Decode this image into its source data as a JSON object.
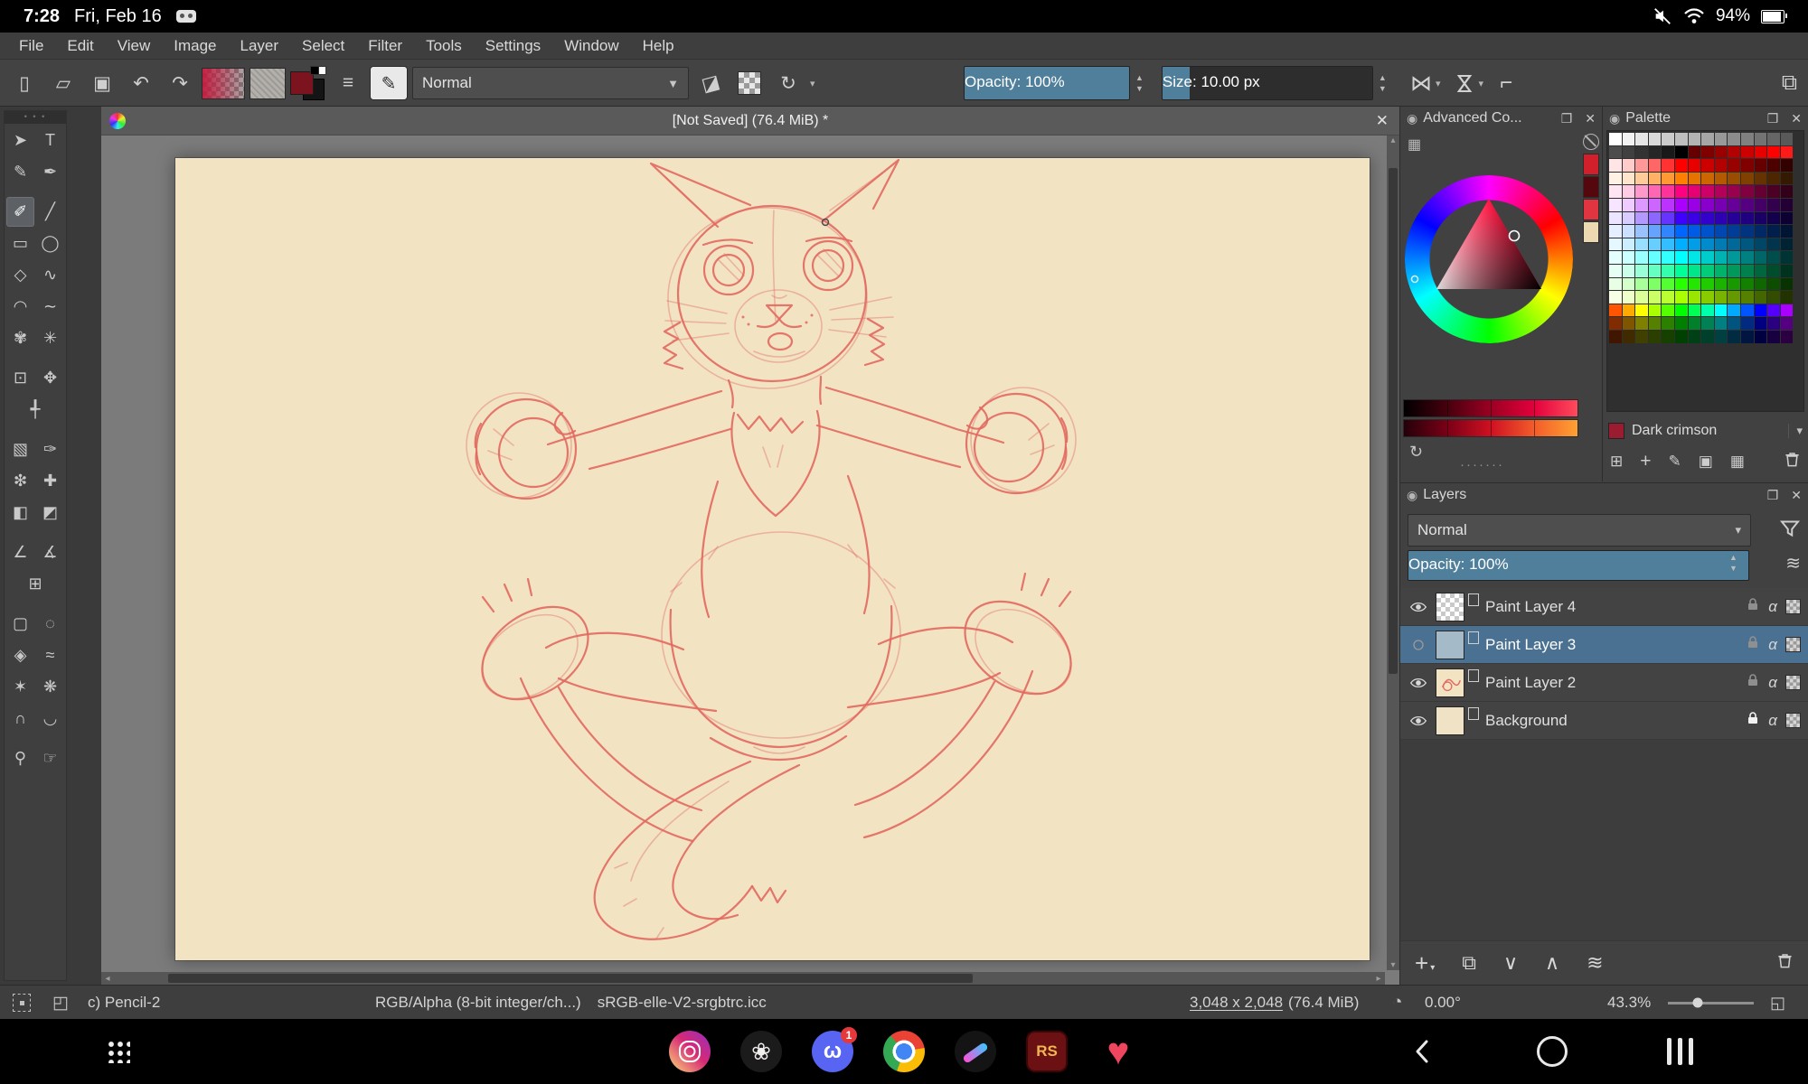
{
  "colors": {
    "accent_teal": "#4f7f9b",
    "selection_blue": "#4a7191",
    "canvas_paper": "#f2e3c3",
    "sketch": "#e2685f"
  },
  "status_bar": {
    "time": "7:28",
    "date": "Fri, Feb 16",
    "battery_percent": "94%"
  },
  "menu_bar": {
    "items": [
      "File",
      "Edit",
      "View",
      "Image",
      "Layer",
      "Select",
      "Filter",
      "Tools",
      "Settings",
      "Window",
      "Help"
    ]
  },
  "toolbar": {
    "blending_mode": "Normal",
    "opacity_label": "Opacity: 100%",
    "size_label": "Size: 10.00 px"
  },
  "document_tab": {
    "title": "[Not Saved]  (76.4 MiB)  *"
  },
  "toolbox": {
    "rows": [
      {
        "gap": false,
        "tools": [
          {
            "name": "shape-select-tool",
            "glyph": "➤"
          },
          {
            "name": "text-tool",
            "glyph": "T"
          }
        ]
      },
      {
        "gap": false,
        "tools": [
          {
            "name": "edit-shapes-tool",
            "glyph": "✎"
          },
          {
            "name": "calligraphy-tool",
            "glyph": "✒"
          }
        ]
      },
      {
        "gap": true,
        "tools": [
          {
            "name": "freehand-brush-tool",
            "glyph": "✐",
            "selected": true
          },
          {
            "name": "line-tool",
            "glyph": "╱"
          }
        ]
      },
      {
        "gap": false,
        "tools": [
          {
            "name": "rectangle-tool",
            "glyph": "▭"
          },
          {
            "name": "ellipse-tool",
            "glyph": "◯"
          }
        ]
      },
      {
        "gap": false,
        "tools": [
          {
            "name": "polygon-tool",
            "glyph": "◇"
          },
          {
            "name": "polyline-tool",
            "glyph": "∿"
          }
        ]
      },
      {
        "gap": false,
        "tools": [
          {
            "name": "bezier-curve-tool",
            "glyph": "◠"
          },
          {
            "name": "freehand-path-tool",
            "glyph": "∼"
          }
        ]
      },
      {
        "gap": false,
        "tools": [
          {
            "name": "dynamic-brush-tool",
            "glyph": "✾"
          },
          {
            "name": "multibrush-tool",
            "glyph": "✳"
          }
        ]
      },
      {
        "gap": true,
        "tools": [
          {
            "name": "transform-tool",
            "glyph": "⊡"
          },
          {
            "name": "move-tool",
            "glyph": "✥"
          }
        ]
      },
      {
        "gap": false,
        "tools": [
          {
            "name": "crop-tool",
            "glyph": "╃"
          }
        ]
      },
      {
        "gap": true,
        "tools": [
          {
            "name": "gradient-tool",
            "glyph": "▧"
          },
          {
            "name": "color-sampler-tool",
            "glyph": "✑"
          }
        ]
      },
      {
        "gap": false,
        "tools": [
          {
            "name": "colorize-mask-tool",
            "glyph": "❇"
          },
          {
            "name": "smart-patch-tool",
            "glyph": "✚"
          }
        ]
      },
      {
        "gap": false,
        "tools": [
          {
            "name": "fill-tool",
            "glyph": "◧"
          },
          {
            "name": "enclose-fill-tool",
            "glyph": "◩"
          }
        ]
      },
      {
        "gap": true,
        "tools": [
          {
            "name": "assistants-tool",
            "glyph": "∠"
          },
          {
            "name": "measure-tool",
            "glyph": "∡"
          }
        ]
      },
      {
        "gap": false,
        "tools": [
          {
            "name": "reference-images-tool",
            "glyph": "⊞"
          }
        ]
      },
      {
        "gap": true,
        "tools": [
          {
            "name": "rectangular-selection-tool",
            "glyph": "▢"
          },
          {
            "name": "elliptical-selection-tool",
            "glyph": "◌"
          }
        ]
      },
      {
        "gap": false,
        "tools": [
          {
            "name": "polygonal-selection-tool",
            "glyph": "◈"
          },
          {
            "name": "freehand-selection-tool",
            "glyph": "≈"
          }
        ]
      },
      {
        "gap": false,
        "tools": [
          {
            "name": "contiguous-selection-tool",
            "glyph": "✶"
          },
          {
            "name": "similar-color-selection-tool",
            "glyph": "❋"
          }
        ]
      },
      {
        "gap": false,
        "tools": [
          {
            "name": "magnetic-selection-tool",
            "glyph": "∩"
          },
          {
            "name": "bezier-selection-tool",
            "glyph": "◡"
          }
        ]
      },
      {
        "gap": true,
        "tools": [
          {
            "name": "zoom-tool",
            "glyph": "⚲"
          },
          {
            "name": "pan-tool",
            "glyph": "☞"
          }
        ]
      }
    ]
  },
  "advanced_color_selector": {
    "title": "Advanced Co...",
    "recent_colors": [
      "#d1202c",
      "#54070d",
      "#e03440",
      "#ecd9b2"
    ],
    "gradient_strip_top": [
      "#000000",
      "#47000e",
      "#9b0022",
      "#e3003c",
      "#ff4b5c"
    ],
    "gradient_strip_bottom": [
      "#24000a",
      "#7a0016",
      "#cf1022",
      "#f25c2a",
      "#ffa133"
    ]
  },
  "palette": {
    "title": "Palette",
    "selected_color_name": "Dark crimson",
    "selected_color_hex": "#9b1b30",
    "rows": [
      [
        "#ffffff",
        "#f2f2f2",
        "#e6e6e6",
        "#d9d9d9",
        "#cccccc",
        "#bfbfbf",
        "#b3b3b3",
        "#a6a6a6",
        "#999999",
        "#8c8c8c",
        "#808080",
        "#737373",
        "#666666",
        "#595959"
      ],
      [
        "#4d4d4d",
        "#404040",
        "#333333",
        "#262626",
        "#191919",
        "#000000",
        "#660000",
        "#800000",
        "#990000",
        "#b30000",
        "#cc0000",
        "#e60000",
        "#ff0000",
        "#ff1a1a"
      ],
      [
        "#ffe5e5",
        "#ffcccc",
        "#ff9999",
        "#ff6666",
        "#ff3333",
        "#ff0000",
        "#e60000",
        "#cc0000",
        "#b30000",
        "#990000",
        "#800000",
        "#660000",
        "#4d0000",
        "#330000"
      ],
      [
        "#fff2e5",
        "#ffe5cc",
        "#ffcc99",
        "#ffb266",
        "#ff9933",
        "#ff8000",
        "#e67300",
        "#cc6600",
        "#b35900",
        "#994d00",
        "#804000",
        "#663300",
        "#4d2600",
        "#331a00"
      ],
      [
        "#ffe5f2",
        "#ffcce6",
        "#ff99cc",
        "#ff66b3",
        "#ff3399",
        "#ff0080",
        "#e60073",
        "#cc0066",
        "#b30059",
        "#99004d",
        "#800040",
        "#660033",
        "#4d0026",
        "#33001a"
      ],
      [
        "#f7e5ff",
        "#eeccff",
        "#dd99ff",
        "#cc66ff",
        "#bb33ff",
        "#aa00ff",
        "#9900e6",
        "#8800cc",
        "#7700b3",
        "#660099",
        "#550080",
        "#440066",
        "#33004d",
        "#220033"
      ],
      [
        "#ece5ff",
        "#d9ccff",
        "#b399ff",
        "#8c66ff",
        "#6633ff",
        "#4000ff",
        "#3a00e6",
        "#3300cc",
        "#2d00b3",
        "#260099",
        "#200080",
        "#1a0066",
        "#13004d",
        "#0d0033"
      ],
      [
        "#e5efff",
        "#cce0ff",
        "#99c2ff",
        "#66a3ff",
        "#3385ff",
        "#0066ff",
        "#005ce6",
        "#0052cc",
        "#0047b3",
        "#003d99",
        "#003380",
        "#002966",
        "#001f4d",
        "#001433"
      ],
      [
        "#e5f7ff",
        "#ccefff",
        "#99dfff",
        "#66cfff",
        "#33bfff",
        "#00afff",
        "#009ee6",
        "#008ccc",
        "#007bb3",
        "#006999",
        "#005880",
        "#004666",
        "#00354d",
        "#002333"
      ],
      [
        "#e5ffff",
        "#ccffff",
        "#99ffff",
        "#66ffff",
        "#33ffff",
        "#00ffff",
        "#00e6e6",
        "#00cccc",
        "#00b3b3",
        "#009999",
        "#008080",
        "#006666",
        "#004d4d",
        "#003333"
      ],
      [
        "#e5fff5",
        "#ccffeb",
        "#99ffd6",
        "#66ffc2",
        "#33ffad",
        "#00ff99",
        "#00e68a",
        "#00cc7a",
        "#00b36b",
        "#00995c",
        "#00804d",
        "#00663d",
        "#004d2e",
        "#00331f"
      ],
      [
        "#e9ffe5",
        "#d4ffcc",
        "#a9ff99",
        "#7eff66",
        "#53ff33",
        "#28ff00",
        "#24e600",
        "#20cc00",
        "#1cb300",
        "#189900",
        "#148000",
        "#106600",
        "#0c4d00",
        "#083300"
      ],
      [
        "#f7ffe5",
        "#eeffcc",
        "#ddff99",
        "#ccff66",
        "#bbff33",
        "#aaff00",
        "#99e600",
        "#88cc00",
        "#77b300",
        "#669900",
        "#558000",
        "#446600",
        "#334d00",
        "#223300"
      ],
      [
        "#ff5500",
        "#ffaa00",
        "#ffff00",
        "#aaff00",
        "#55ff00",
        "#00ff00",
        "#00ff55",
        "#00ffaa",
        "#00ffff",
        "#00aaff",
        "#0055ff",
        "#0000ff",
        "#5500ff",
        "#aa00ff"
      ],
      [
        "#802b00",
        "#805500",
        "#808000",
        "#558000",
        "#2b8000",
        "#008000",
        "#00802b",
        "#008055",
        "#008080",
        "#005580",
        "#002b80",
        "#000080",
        "#2b0080",
        "#550080"
      ],
      [
        "#401600",
        "#402b00",
        "#404000",
        "#2b4000",
        "#164000",
        "#004000",
        "#004016",
        "#00402b",
        "#004040",
        "#002b40",
        "#001640",
        "#000040",
        "#160040",
        "#2b0040"
      ]
    ]
  },
  "layers": {
    "title": "Layers",
    "blending_mode": "Normal",
    "opacity_label": "Opacity:  100%",
    "items": [
      {
        "name": "Paint Layer 4",
        "visible": true,
        "selected": false,
        "locked": false,
        "thumb": "thumb-checker"
      },
      {
        "name": "Paint Layer 3",
        "visible": false,
        "selected": true,
        "locked": false,
        "thumb": "thumb-blue"
      },
      {
        "name": "Paint Layer 2",
        "visible": true,
        "selected": false,
        "locked": false,
        "thumb": "thumb-sketch"
      },
      {
        "name": "Background",
        "visible": true,
        "selected": false,
        "locked": true,
        "thumb": "thumb-cream"
      }
    ]
  },
  "status_info": {
    "brush_preset": "c) Pencil-2",
    "color_mode": "RGB/Alpha (8-bit integer/ch...)",
    "color_profile": "sRGB-elle-V2-srgbtrc.icc",
    "dimensions": "3,048 x 2,048",
    "memory": "(76.4 MiB)",
    "rotation": "0.00°",
    "zoom": "43.3%"
  },
  "android_nav": {
    "discord_badge": "1",
    "rs_label": "RS"
  }
}
